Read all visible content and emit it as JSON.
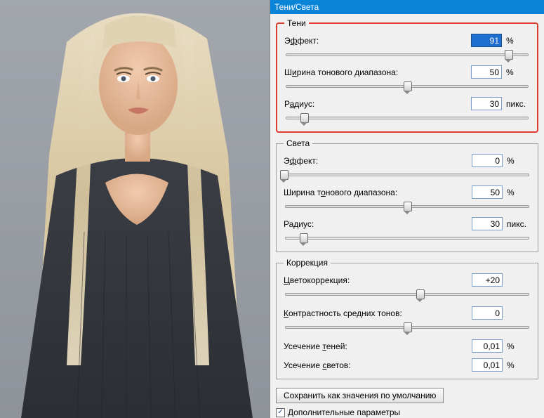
{
  "title": "Тени/Света",
  "shadows": {
    "legend": "Тени",
    "amount": {
      "label_pre": "Э",
      "label_u": "ф",
      "label_post": "фект:",
      "value": "91",
      "unit": "%",
      "pos": 91,
      "selected": true
    },
    "tonal": {
      "label_pre": "Ш",
      "label_u": "и",
      "label_post": "рина тонового диапазона:",
      "value": "50",
      "unit": "%",
      "pos": 50
    },
    "radius": {
      "label_pre": "Р",
      "label_u": "а",
      "label_post": "диус:",
      "value": "30",
      "unit": "пикс.",
      "pos": 8
    }
  },
  "highlights": {
    "legend": "Света",
    "amount": {
      "label_pre": "Э",
      "label_u": "ф",
      "label_post": "фект:",
      "value": "0",
      "unit": "%",
      "pos": 0
    },
    "tonal": {
      "label_pre": "Ширина т",
      "label_u": "о",
      "label_post": "нового диапазона:",
      "value": "50",
      "unit": "%",
      "pos": 50
    },
    "radius": {
      "label_pre": "Ра",
      "label_u": "д",
      "label_post": "иус:",
      "value": "30",
      "unit": "пикс.",
      "pos": 8
    }
  },
  "correction": {
    "legend": "Коррекция",
    "color": {
      "label_pre": "",
      "label_u": "Ц",
      "label_post": "ветокоррекция:",
      "value": "+20",
      "unit": "",
      "pos": 55
    },
    "midtone": {
      "label_pre": "",
      "label_u": "К",
      "label_post": "онтрастность средних тонов:",
      "value": "0",
      "unit": "",
      "pos": 50
    },
    "clip_shadow": {
      "label_pre": "Усечение ",
      "label_u": "т",
      "label_post": "еней:",
      "value": "0,01",
      "unit": "%"
    },
    "clip_high": {
      "label_pre": "Усечение ",
      "label_u": "с",
      "label_post": "ветов:",
      "value": "0,01",
      "unit": "%"
    }
  },
  "save_defaults": {
    "label_pre": "Сохранит",
    "label_u": "ь",
    "label_post": " как значения по умолчанию"
  },
  "more_options": {
    "label_pre": "Дополнительные параметр",
    "label_u": "ы",
    "label_post": "",
    "checked": true
  }
}
